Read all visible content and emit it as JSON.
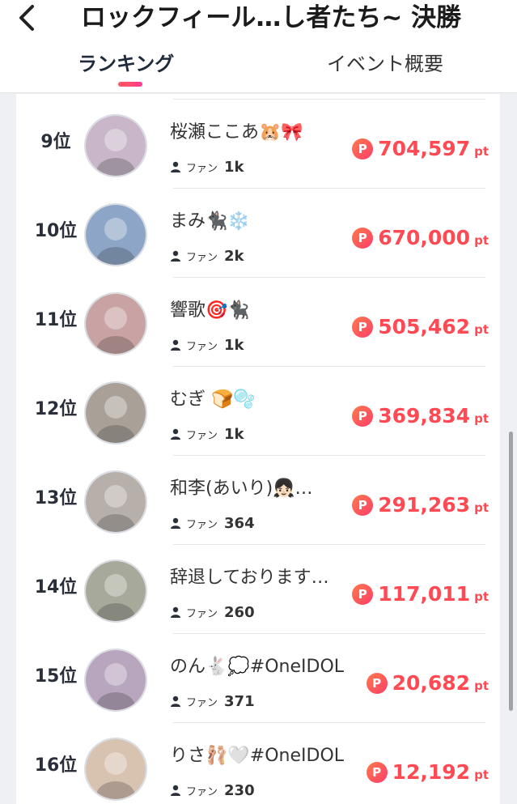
{
  "header": {
    "title": "ロックフィール…し者たち~ 決勝",
    "tabs": [
      {
        "label": "ランキング",
        "active": true
      },
      {
        "label": "イベント概要",
        "active": false
      }
    ]
  },
  "colors": {
    "accent": "#ff4a54",
    "active_underline": "#ff3a6a"
  },
  "ranking": [
    {
      "rank": "9位",
      "name": "桜瀬ここあ🐹🎀",
      "fan_label": "ファン",
      "fans": "1k",
      "points": "704,597",
      "unit": "pt",
      "avatar_color": "#c9b7c9"
    },
    {
      "rank": "10位",
      "name": "まみ🐈‍⬛❄️",
      "fan_label": "ファン",
      "fans": "2k",
      "points": "670,000",
      "unit": "pt",
      "avatar_color": "#8da6c7"
    },
    {
      "rank": "11位",
      "name": "響歌🎯🐈‍⬛",
      "fan_label": "ファン",
      "fans": "1k",
      "points": "505,462",
      "unit": "pt",
      "avatar_color": "#c9a3a3"
    },
    {
      "rank": "12位",
      "name": "むぎ 🍞🫧",
      "fan_label": "ファン",
      "fans": "1k",
      "points": "369,834",
      "unit": "pt",
      "avatar_color": "#a9a098"
    },
    {
      "rank": "13位",
      "name": "和李(あいり)👧🏻…",
      "fan_label": "ファン",
      "fans": "364",
      "points": "291,263",
      "unit": "pt",
      "avatar_color": "#b7b0aa"
    },
    {
      "rank": "14位",
      "name": "辞退しております…",
      "fan_label": "ファン",
      "fans": "260",
      "points": "117,011",
      "unit": "pt",
      "avatar_color": "#a7a99a"
    },
    {
      "rank": "15位",
      "name": "のん🐇💭#OneIDOL",
      "fan_label": "ファン",
      "fans": "371",
      "points": "20,682",
      "unit": "pt",
      "avatar_color": "#b8a6bf"
    },
    {
      "rank": "16位",
      "name": "りさ🩰🤍#OneIDOL",
      "fan_label": "ファン",
      "fans": "230",
      "points": "12,192",
      "unit": "pt",
      "avatar_color": "#d8c2b0"
    }
  ]
}
